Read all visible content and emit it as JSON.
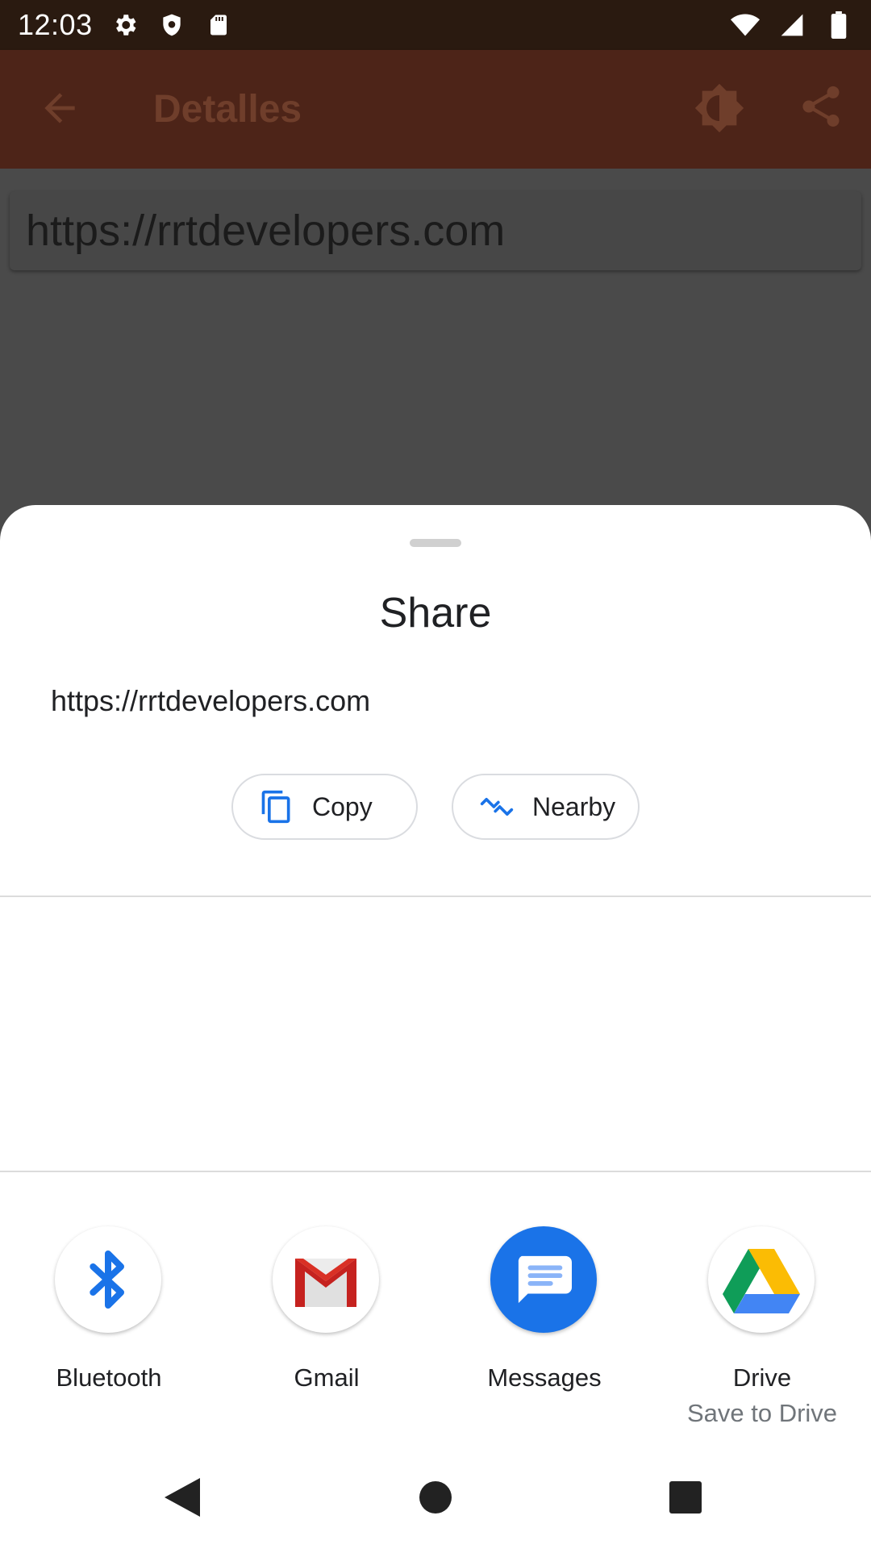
{
  "status_bar": {
    "time": "12:03",
    "icons_left": [
      "gear-icon",
      "shield-icon",
      "sd-card-icon"
    ],
    "icons_right": [
      "wifi-icon",
      "signal-icon",
      "battery-icon"
    ]
  },
  "app_bar": {
    "title": "Detalles",
    "icons": [
      "back-arrow-icon",
      "brightness-icon",
      "share-icon"
    ]
  },
  "content": {
    "url": "https://rrtdevelopers.com"
  },
  "share_sheet": {
    "title": "Share",
    "shared_text": "https://rrtdevelopers.com",
    "chips": {
      "copy_label": "Copy",
      "nearby_label": "Nearby"
    },
    "apps": [
      {
        "label": "Bluetooth",
        "sublabel": ""
      },
      {
        "label": "Gmail",
        "sublabel": ""
      },
      {
        "label": "Messages",
        "sublabel": ""
      },
      {
        "label": "Drive",
        "sublabel": "Save to Drive"
      }
    ]
  },
  "colors": {
    "status_bar": "#2a1a10",
    "app_bar_dimmed": "#4d2418",
    "scrim": "#4a4a4a",
    "accent_blue": "#1a73e8"
  }
}
